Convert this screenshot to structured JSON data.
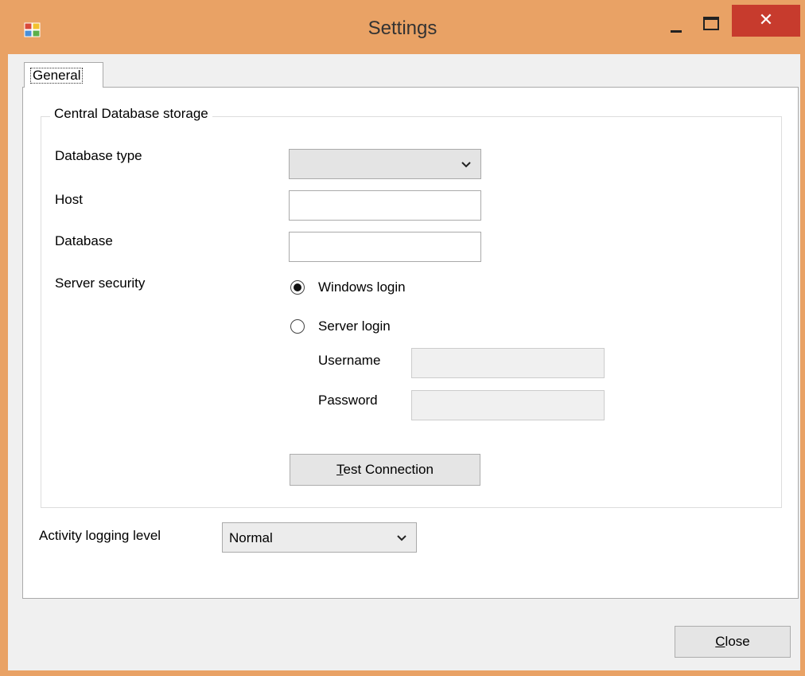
{
  "window": {
    "title": "Settings",
    "close_glyph": "✕",
    "icons": {
      "app": "app-icon",
      "minimize": "minimize-icon",
      "maximize": "maximize-icon",
      "close": "close-icon"
    },
    "accent_color": "#e9a265",
    "close_color": "#c73b2d"
  },
  "tabs": [
    {
      "label": "General",
      "selected": true
    }
  ],
  "group": {
    "title": "Central Database storage",
    "database_type": {
      "label": "Database type",
      "value": ""
    },
    "host": {
      "label": "Host",
      "value": ""
    },
    "database": {
      "label": "Database",
      "value": ""
    },
    "server_security": {
      "label": "Server security",
      "options": [
        {
          "label": "Windows login",
          "checked": true
        },
        {
          "label": "Server login",
          "checked": false
        }
      ],
      "username": {
        "label": "Username",
        "value": ""
      },
      "password": {
        "label": "Password",
        "value": ""
      }
    },
    "test_button": {
      "mnemonic": "T",
      "rest": "est Connection"
    }
  },
  "logging": {
    "label": "Activity logging level",
    "value": "Normal"
  },
  "close_button": {
    "mnemonic": "C",
    "rest": "lose"
  }
}
